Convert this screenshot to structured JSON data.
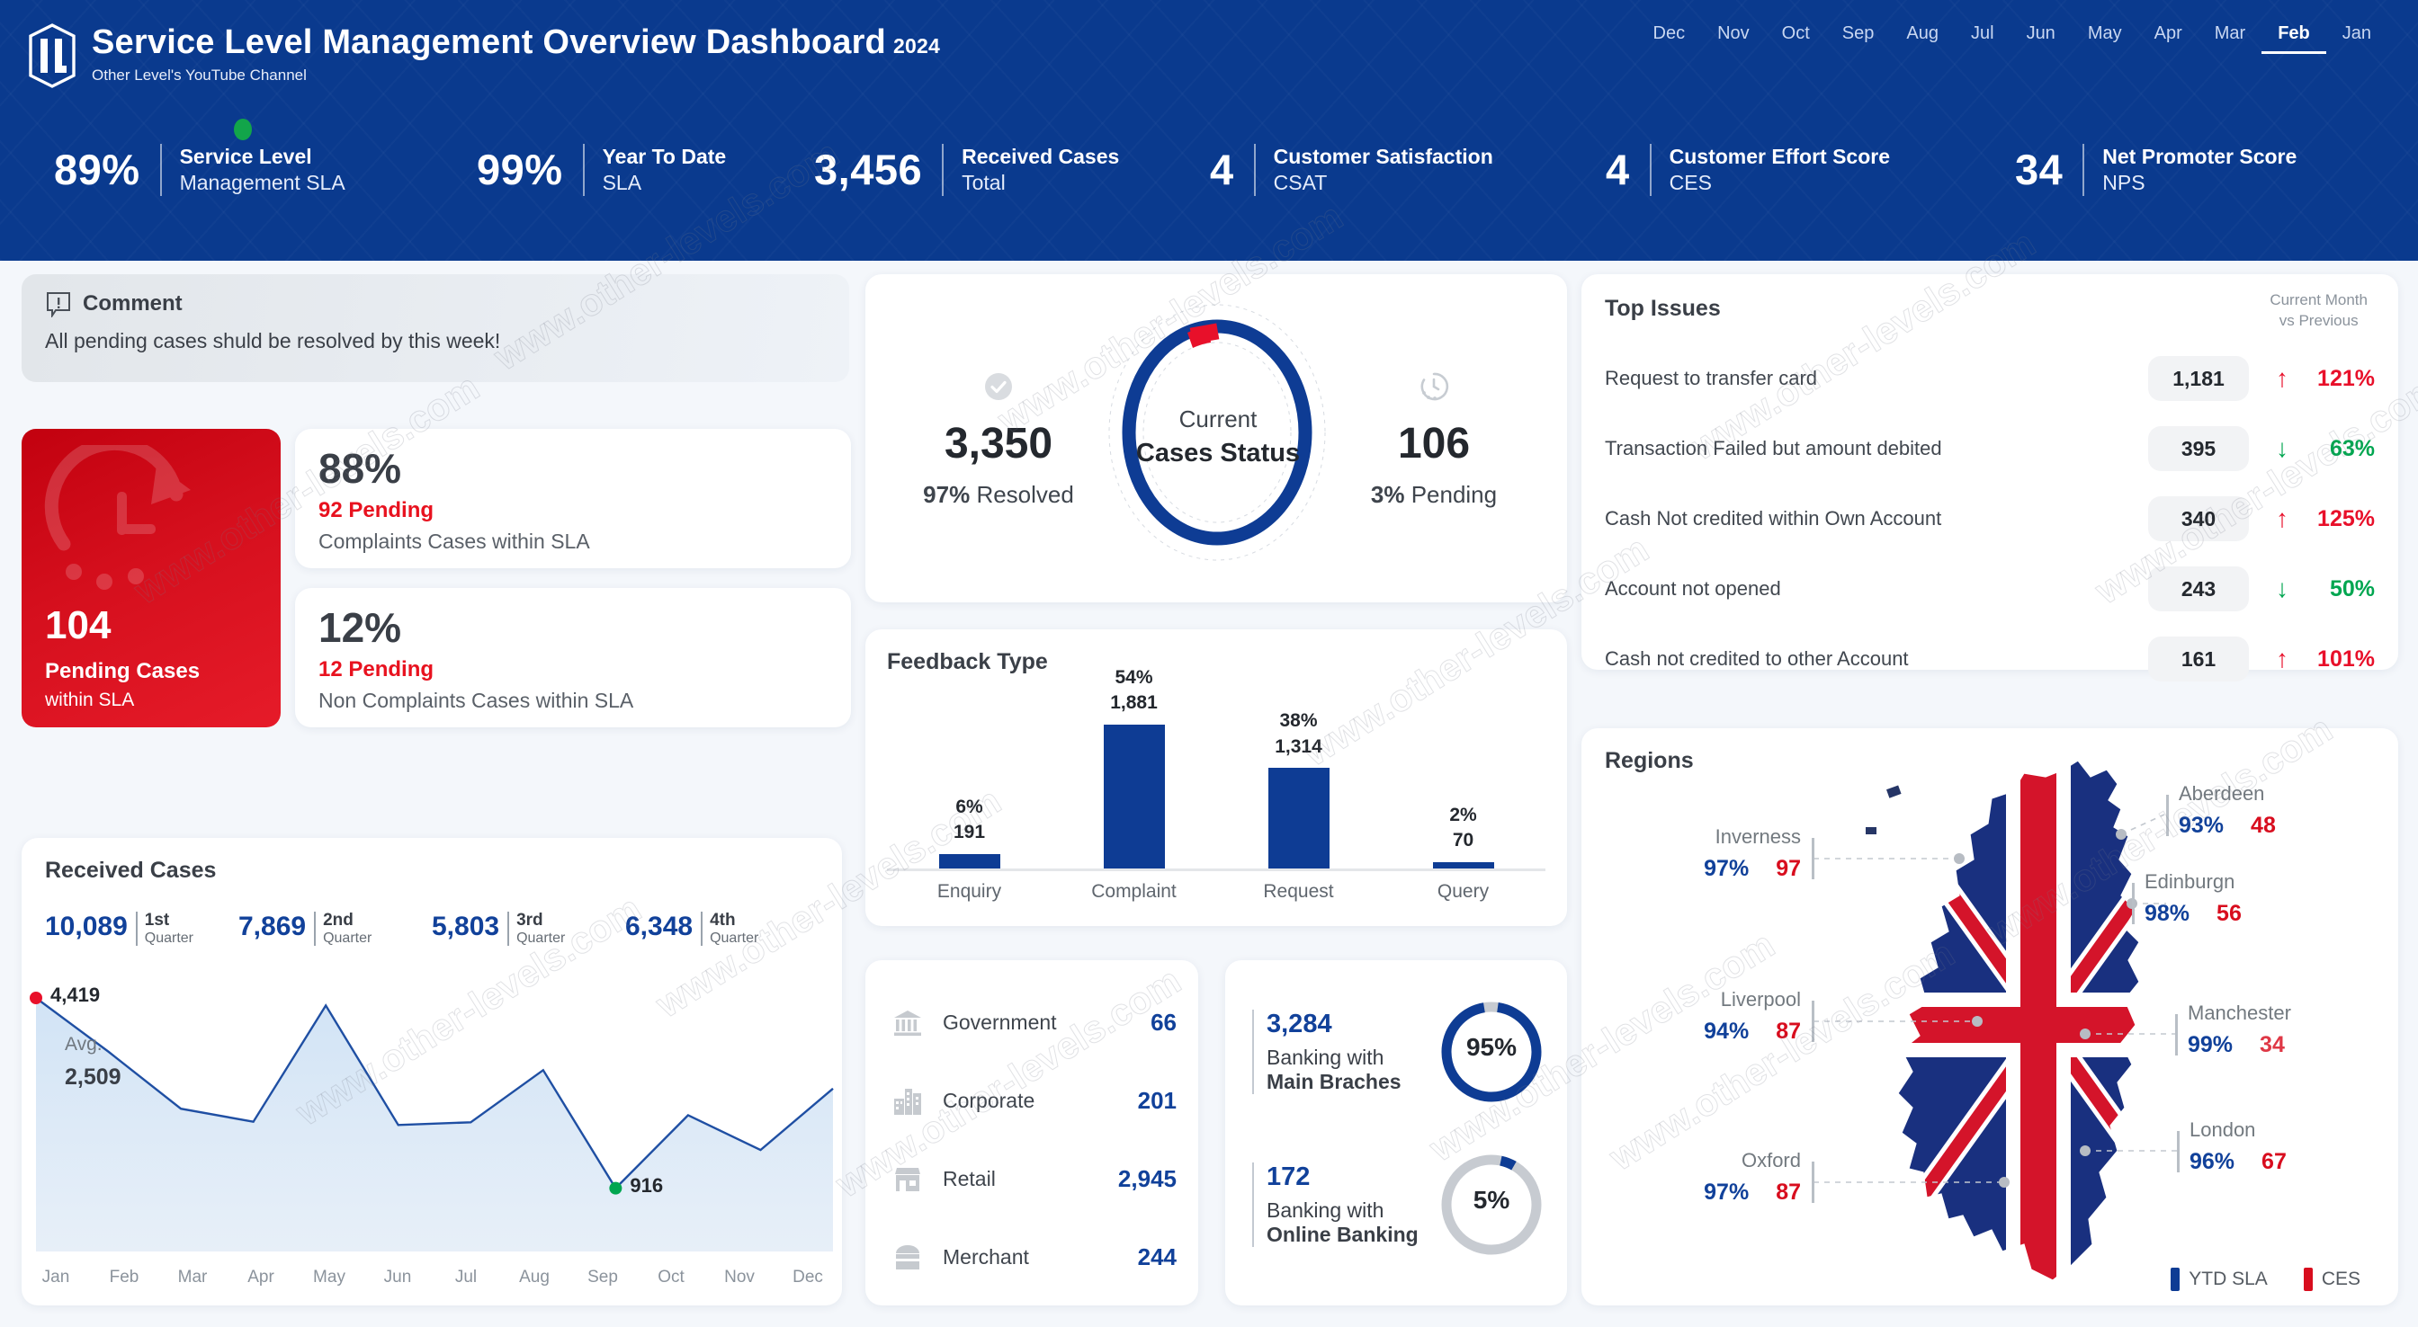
{
  "header": {
    "title": "Service Level Management Overview Dashboard",
    "year": "2024",
    "subtitle": "Other Level's YouTube Channel",
    "brand_color": "#0a3a8e",
    "logo_icon": "ol-monogram-shield-icon",
    "months": [
      "Dec",
      "Nov",
      "Oct",
      "Sep",
      "Aug",
      "Jul",
      "Jun",
      "May",
      "Apr",
      "Mar",
      "Feb",
      "Jan"
    ],
    "active_month": "Feb"
  },
  "kpis": [
    {
      "value": "89%",
      "line1_bold": "Service Level",
      "line2_bold": "Management",
      "line2_light": "SLA",
      "status_dot": "#12a54a"
    },
    {
      "value": "99%",
      "line1_bold": "Year To Date",
      "line2_light": "SLA"
    },
    {
      "value": "3,456",
      "line1_bold": "Received Cases",
      "line2_light": "Total"
    },
    {
      "value": "4",
      "line1_bold": "Customer Satisfaction",
      "line2_light": "CSAT"
    },
    {
      "value": "4",
      "line1_bold": "Customer Effort Score",
      "line2_light": "CES"
    },
    {
      "value": "34",
      "line1_bold": "Net Promoter Score",
      "line2_light": "NPS"
    }
  ],
  "comment": {
    "icon": "comment-alert-icon",
    "title": "Comment",
    "text": "All pending cases shuld be resolved by this week!"
  },
  "pending_card": {
    "icon": "clock-rotate-icon",
    "number": "104",
    "label_bold": "Pending Cases",
    "label_light": "within SLA",
    "color": "#d50f1d"
  },
  "sla_cards": [
    {
      "percent": "88%",
      "pending": "92 Pending",
      "pending_num": "92",
      "pending_word": "Pending",
      "description": "Complaints Cases within SLA"
    },
    {
      "percent": "12%",
      "pending": "12 Pending",
      "pending_num": "12",
      "pending_word": "Pending",
      "description": "Non Complaints Cases within SLA"
    }
  ],
  "received_cases": {
    "title": "Received Cases",
    "quarters": [
      {
        "value": "10,089",
        "ord": "1st",
        "unit": "Quarter"
      },
      {
        "value": "7,869",
        "ord": "2nd",
        "unit": "Quarter"
      },
      {
        "value": "5,803",
        "ord": "3rd",
        "unit": "Quarter"
      },
      {
        "value": "6,348",
        "ord": "4th",
        "unit": "Quarter"
      }
    ],
    "avg_label": "Avg.",
    "avg_value": "2,509",
    "max_label": "4,419",
    "min_label": "916"
  },
  "cases_status": {
    "center_line1": "Current",
    "center_line2": "Cases Status",
    "resolved": {
      "icon": "check-circle-icon",
      "value": "3,350",
      "percent": "97%",
      "label": "Resolved"
    },
    "pending": {
      "icon": "clock-icon",
      "value": "106",
      "percent": "3%",
      "label": "Pending"
    },
    "donut_color": "#0e3c94",
    "donut_accent": "#e8102a"
  },
  "feedback": {
    "title": "Feedback Type"
  },
  "segments": [
    {
      "icon": "bank-icon",
      "name": "Government",
      "value": "66"
    },
    {
      "icon": "buildings-icon",
      "name": "Corporate",
      "value": "201"
    },
    {
      "icon": "store-icon",
      "name": "Retail",
      "value": "2,945"
    },
    {
      "icon": "shop-icon",
      "name": "Merchant",
      "value": "244"
    }
  ],
  "banking": [
    {
      "number": "3,284",
      "line1": "Banking with",
      "line2": "Main Braches",
      "gauge": "95%",
      "gauge_value": 95,
      "active": true
    },
    {
      "number": "172",
      "line1": "Banking with",
      "line2": "Online Banking",
      "gauge": "5%",
      "gauge_value": 5,
      "active": false
    }
  ],
  "top_issues": {
    "title": "Top Issues",
    "header_line1": "Current Month",
    "header_line2": "vs Previous",
    "rows": [
      {
        "name": "Request to transfer card",
        "count": "1,181",
        "direction": "up",
        "arrow": "↑",
        "percent": "121%"
      },
      {
        "name": "Transaction Failed but amount debited",
        "count": "395",
        "direction": "down",
        "arrow": "↓",
        "percent": "63%"
      },
      {
        "name": "Cash Not credited within Own Account",
        "count": "340",
        "direction": "up",
        "arrow": "↑",
        "percent": "125%"
      },
      {
        "name": "Account not opened",
        "count": "243",
        "direction": "down",
        "arrow": "↓",
        "percent": "50%"
      },
      {
        "name": "Cash not credited  to other Account",
        "count": "161",
        "direction": "up",
        "arrow": "↑",
        "percent": "101%"
      }
    ]
  },
  "regions": {
    "title": "Regions",
    "items": [
      {
        "city": "Inverness",
        "sla": "97%",
        "ces": "97",
        "side": "left"
      },
      {
        "city": "Liverpool",
        "sla": "94%",
        "ces": "87",
        "side": "left"
      },
      {
        "city": "Oxford",
        "sla": "97%",
        "ces": "87",
        "side": "left"
      },
      {
        "city": "Aberdeen",
        "sla": "93%",
        "ces": "48",
        "side": "right"
      },
      {
        "city": "Edinburgn",
        "sla": "98%",
        "ces": "56",
        "side": "right"
      },
      {
        "city": "Manchester",
        "sla": "99%",
        "ces": "34",
        "side": "right"
      },
      {
        "city": "London",
        "sla": "96%",
        "ces": "67",
        "side": "right"
      }
    ],
    "legend": [
      {
        "label": "YTD SLA",
        "color": "#0e3c94"
      },
      {
        "label": "CES",
        "color": "#d80d1e"
      }
    ]
  },
  "watermark_text": "www.other-levels.com",
  "chart_data": [
    {
      "type": "area",
      "title": "Received Cases",
      "x": [
        "Jan",
        "Feb",
        "Mar",
        "Apr",
        "May",
        "Jun",
        "Jul",
        "Aug",
        "Sep",
        "Oct",
        "Nov",
        "Dec"
      ],
      "values": [
        4419,
        3430,
        2380,
        2140,
        4280,
        2080,
        2130,
        3090,
        916,
        2260,
        1620,
        2750
      ],
      "ylabel": "",
      "xlabel": "",
      "annotations": [
        {
          "x": "Jan",
          "label": "4,419",
          "marker_color": "#e8102a"
        },
        {
          "x": "Sep",
          "label": "916",
          "marker_color": "#00a650"
        }
      ],
      "average": 2509,
      "grid": false,
      "line_color": "#1f4fa3",
      "fill_color": "#dbe9f7"
    },
    {
      "type": "bar",
      "title": "Feedback Type",
      "categories": [
        "Enquiry",
        "Complaint",
        "Request",
        "Query"
      ],
      "values": [
        191,
        1881,
        1314,
        70
      ],
      "percent_labels": [
        "6%",
        "54%",
        "38%",
        "2%"
      ],
      "value_labels": [
        "191",
        "1,881",
        "1,314",
        "70"
      ],
      "ylim": [
        0,
        1881
      ],
      "grid": false,
      "bar_color": "#0e3c94"
    },
    {
      "type": "pie",
      "title": "Current Cases Status",
      "labels": [
        "Resolved",
        "Pending"
      ],
      "values": [
        3350,
        106
      ],
      "percents": [
        "97%",
        "3%"
      ],
      "colors": [
        "#0e3c94",
        "#e8102a"
      ],
      "donut": true
    },
    {
      "type": "pie",
      "title": "Banking with Main Braches",
      "labels": [
        "Main Braches"
      ],
      "values": [
        95
      ],
      "percents": [
        "95%"
      ],
      "colors": [
        "#0e3c94"
      ],
      "donut": true
    },
    {
      "type": "pie",
      "title": "Banking with Online Banking",
      "labels": [
        "Online Banking"
      ],
      "values": [
        5
      ],
      "percents": [
        "5%"
      ],
      "colors": [
        "#0e3c94"
      ],
      "donut": true
    }
  ]
}
